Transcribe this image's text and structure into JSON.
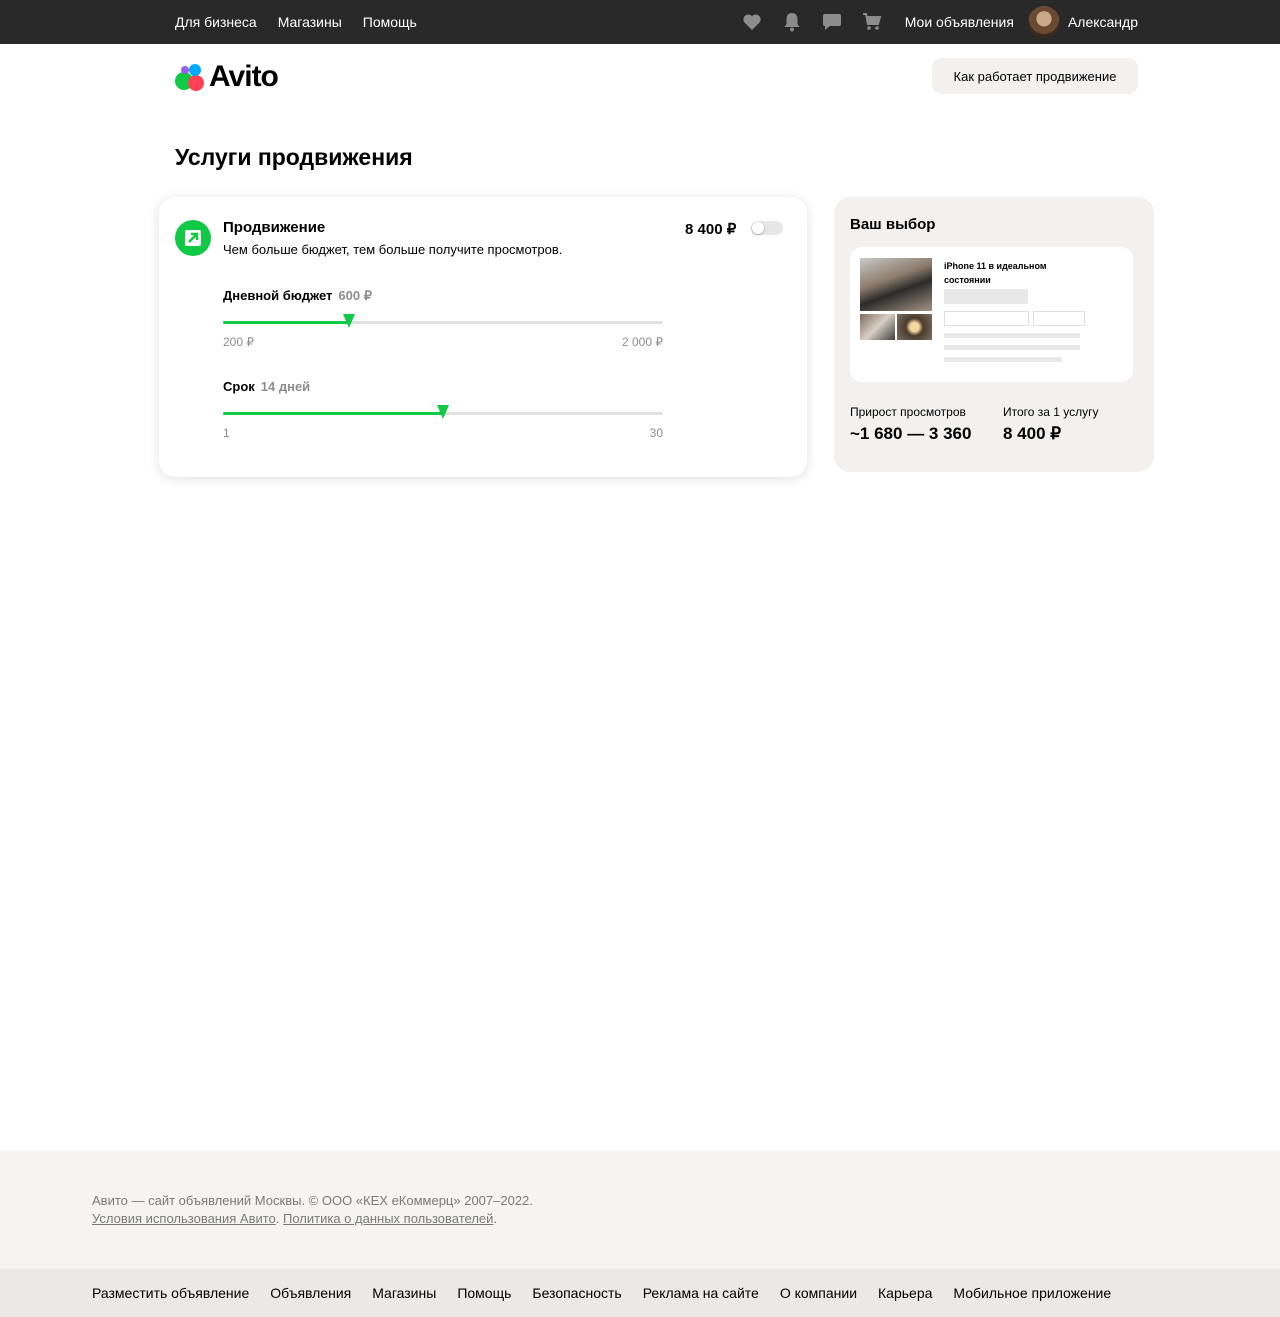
{
  "topbar": {
    "links": [
      "Для бизнеса",
      "Магазины",
      "Помощь"
    ],
    "my_ads": "Мои объявления",
    "username": "Александр",
    "icons": [
      "heart-icon",
      "bell-icon",
      "chat-icon",
      "cart-icon"
    ]
  },
  "header": {
    "logo_text": "Avito",
    "how_button": "Как работает продвижение"
  },
  "page_title": "Услуги продвижения",
  "promo": {
    "title": "Продвижение",
    "subtitle": "Чем больше бюджет, тем больше получите просмотров.",
    "price": "8 400 ₽",
    "toggle_on": false,
    "budget": {
      "label": "Дневной бюджет",
      "value": "600 ₽",
      "min_label": "200 ₽",
      "max_label": "2 000 ₽",
      "fraction": 0.286
    },
    "term": {
      "label": "Срок",
      "value": "14 дней",
      "min_label": "1",
      "max_label": "30",
      "fraction": 0.5
    }
  },
  "choice": {
    "title": "Ваш выбор",
    "preview_title": "iPhone 11 в идеальном состоянии",
    "views_label": "Прирост просмотров",
    "views_value": "~1 680 — 3 360",
    "total_label": "Итого за 1 услугу",
    "total_value": "8 400 ₽"
  },
  "footer": {
    "copyright": "Авито — сайт объявлений Москвы. © ООО «КЕХ еКоммерц» 2007–2022.",
    "terms_link": "Условия использования Авито",
    "privacy_link": "Политика о данных пользователей",
    "nav": [
      "Разместить объявление",
      "Объявления",
      "Магазины",
      "Помощь",
      "Безопасность",
      "Реклама на сайте",
      "О компании",
      "Карьера",
      "Мобильное приложение"
    ]
  },
  "colors": {
    "accent_green": "#10c944",
    "topbar_bg": "#292929",
    "panel_bg": "#f2f1f0"
  }
}
